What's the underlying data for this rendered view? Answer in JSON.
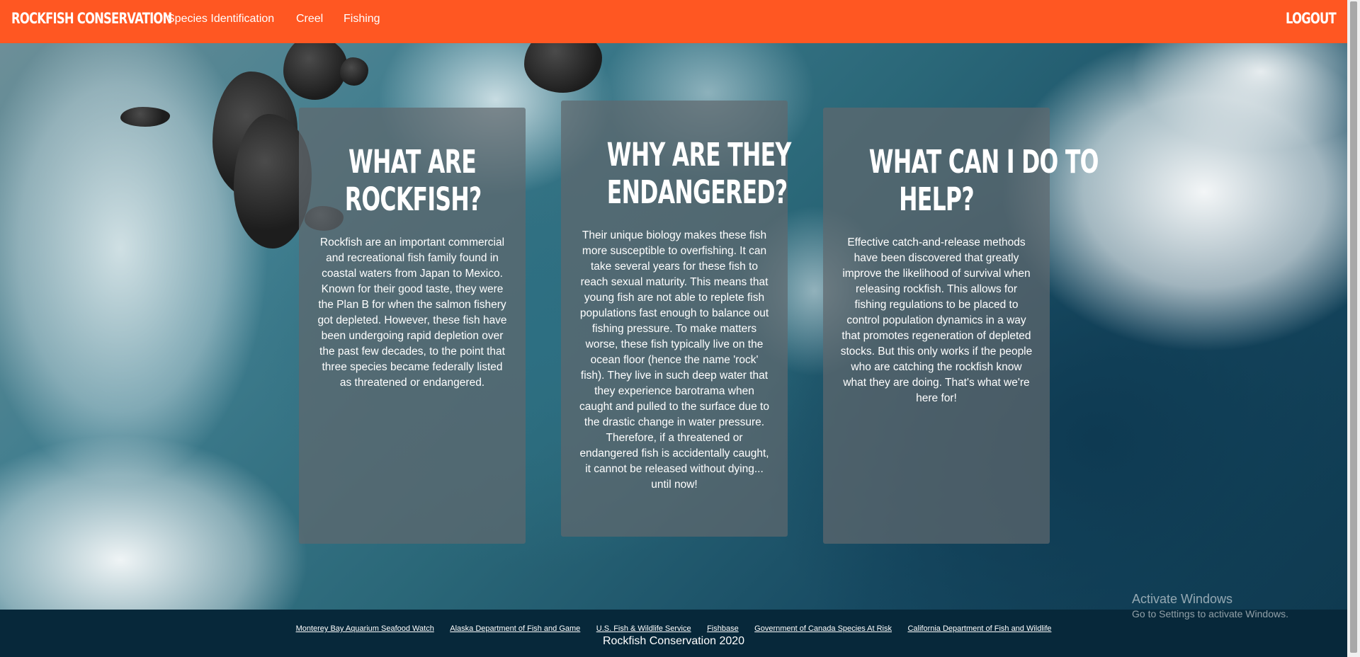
{
  "colors": {
    "navbar_bg": "#ff5722",
    "footer_bg": "#07283a",
    "card_bg": "rgba(96,104,110,0.72)",
    "text": "#ffffff"
  },
  "navbar": {
    "brand": "ROCKFISH CONSERVATION",
    "links": [
      {
        "label": "Species Identification"
      },
      {
        "label": "Creel"
      },
      {
        "label": "Fishing"
      }
    ],
    "logout": "LOGOUT"
  },
  "cards": [
    {
      "title_lines": [
        "WHAT ARE",
        "ROCKFISH?"
      ],
      "body": "Rockfish are an important commercial and recreational fish family found in coastal waters from Japan to Mexico. Known for their good taste, they were the Plan B for when the salmon fishery got depleted. However, these fish have been undergoing rapid depletion over the past few decades, to the point that three species became federally listed as threatened or endangered."
    },
    {
      "title_lines": [
        "WHY ARE THEY",
        "ENDANGERED?"
      ],
      "body": "Their unique biology makes these fish more susceptible to overfishing. It can take several years for these fish to reach sexual maturity. This means that young fish are not able to replete fish populations fast enough to balance out fishing pressure. To make matters worse, these fish typically live on the ocean floor (hence the name 'rock' fish). They live in such deep water that they experience barotrama when caught and pulled to the surface due to the drastic change in water pressure. Therefore, if a threatened or endangered fish is accidentally caught, it cannot be released without dying... until now!"
    },
    {
      "title_lines": [
        "WHAT CAN I DO TO",
        "HELP?"
      ],
      "body": "Effective catch-and-release methods have been discovered that greatly improve the likelihood of survival when releasing rockfish. This allows for fishing regulations to be placed to control population dynamics in a way that promotes regeneration of depleted stocks. But this only works if the people who are catching the rockfish know what they are doing. That's what we're here for!"
    }
  ],
  "footer": {
    "links": [
      {
        "label": "Monterey Bay Aquarium Seafood Watch"
      },
      {
        "label": "Alaska Department of Fish and Game"
      },
      {
        "label": "U.S. Fish & Wildlife Service"
      },
      {
        "label": "Fishbase"
      },
      {
        "label": "Government of Canada Species At Risk"
      },
      {
        "label": "California Department of Fish and Wildlife"
      }
    ],
    "copyright": "Rockfish Conservation 2020"
  },
  "watermark": {
    "title": "Activate Windows",
    "subtitle": "Go to Settings to activate Windows."
  }
}
